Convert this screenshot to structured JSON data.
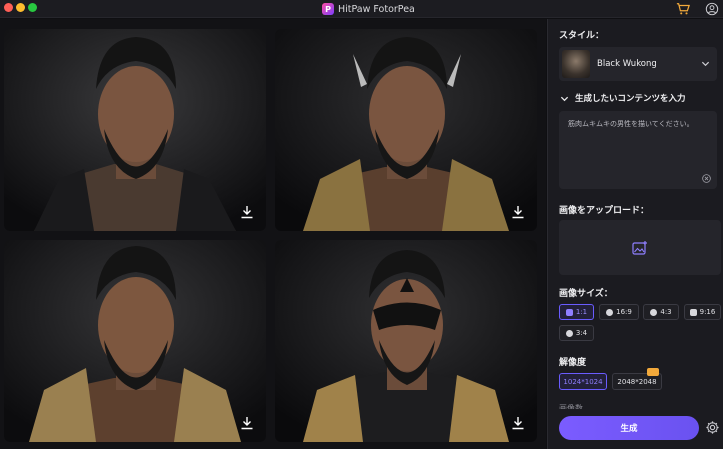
{
  "window": {
    "title": "HitPaw FotorPea"
  },
  "gallery": {
    "images": [
      {
        "name": "generated-image-1"
      },
      {
        "name": "generated-image-2"
      },
      {
        "name": "generated-image-3"
      },
      {
        "name": "generated-image-4"
      }
    ]
  },
  "panel": {
    "style_label": "スタイル：",
    "style_value": "Black Wukong",
    "content_header": "生成したいコンテンツを入力",
    "prompt_text": "筋肉ムキムキの男性を描いてください。",
    "upload_label": "画像をアップロード：",
    "size_label": "画像サイズ：",
    "sizes": [
      {
        "label": "1:1",
        "icon": "square-icon",
        "selected": true
      },
      {
        "label": "16:9",
        "icon": "facebook-icon",
        "selected": false
      },
      {
        "label": "4:3",
        "icon": "twitter-icon",
        "selected": false
      },
      {
        "label": "9:16",
        "icon": "instagram-icon",
        "selected": false
      },
      {
        "label": "3:4",
        "icon": "twitter-icon",
        "selected": false
      }
    ],
    "resolution_label": "解像度",
    "resolutions": [
      {
        "label": "1024*1024",
        "selected": true
      },
      {
        "label": "2048*2048",
        "selected": false,
        "badge": "crown-badge"
      }
    ],
    "count_label_partial": "画像数",
    "generate_label": "生成"
  },
  "colors": {
    "accent": "#6a5cff",
    "generate_button": "#7b5cff",
    "cart": "#f2a93b"
  }
}
